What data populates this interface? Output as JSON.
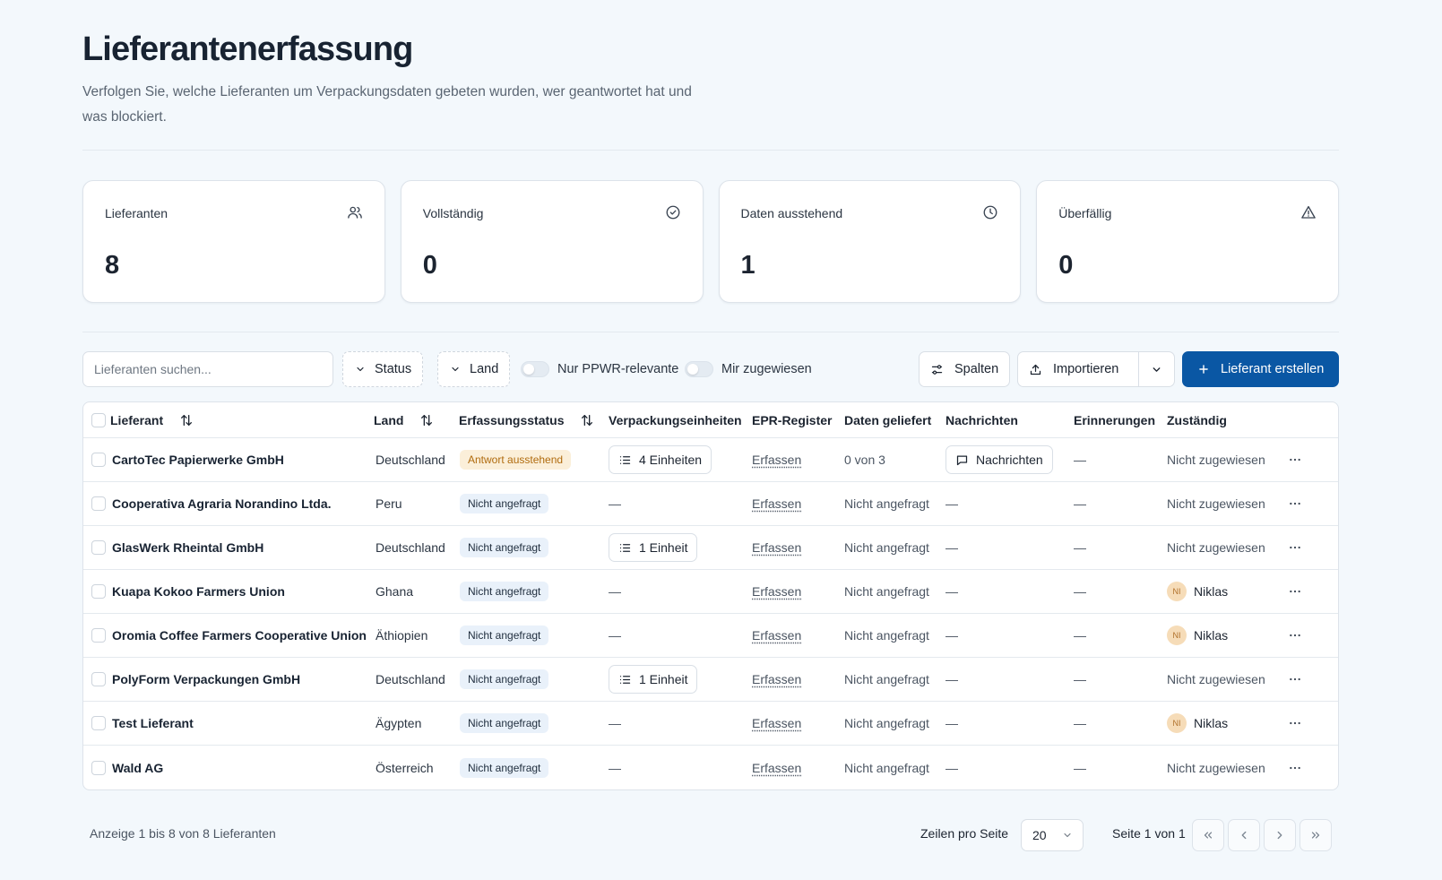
{
  "header": {
    "title": "Lieferantenerfassung",
    "subtitle": "Verfolgen Sie, welche Lieferanten um Verpackungsdaten gebeten wurden, wer geantwortet hat und was blockiert."
  },
  "stats": [
    {
      "label": "Lieferanten",
      "value": "8",
      "icon": "users-icon"
    },
    {
      "label": "Vollständig",
      "value": "0",
      "icon": "check-circle-icon"
    },
    {
      "label": "Daten ausstehend",
      "value": "1",
      "icon": "clock-icon"
    },
    {
      "label": "Überfällig",
      "value": "0",
      "icon": "alert-triangle-icon"
    }
  ],
  "toolbar": {
    "search_placeholder": "Lieferanten suchen...",
    "status_filter": "Status",
    "country_filter": "Land",
    "toggle_ppwr": "Nur PPWR-relevante",
    "toggle_assigned": "Mir zugewiesen",
    "columns_button": "Spalten",
    "import_button": "Importieren",
    "create_button": "Lieferant erstellen"
  },
  "table": {
    "columns": [
      "Lieferant",
      "Land",
      "Erfassungsstatus",
      "Verpackungseinheiten",
      "EPR-Register",
      "Daten geliefert",
      "Nachrichten",
      "Erinnerungen",
      "Zuständig"
    ],
    "rows": [
      {
        "name": "CartoTec Papierwerke GmbH",
        "country": "Deutschland",
        "status": "Antwort ausstehend",
        "status_variant": "amber",
        "units": "4 Einheiten",
        "epr": "Erfassen",
        "delivered": "0 von 3",
        "messages": "Nachrichten",
        "reminders": "—",
        "assignee": "Nicht zugewiesen",
        "assignee_initials": ""
      },
      {
        "name": "Cooperativa Agraria Norandino Ltda.",
        "country": "Peru",
        "status": "Nicht angefragt",
        "status_variant": "blue",
        "units": "—",
        "epr": "Erfassen",
        "delivered": "Nicht angefragt",
        "messages": "—",
        "reminders": "—",
        "assignee": "Nicht zugewiesen",
        "assignee_initials": ""
      },
      {
        "name": "GlasWerk Rheintal GmbH",
        "country": "Deutschland",
        "status": "Nicht angefragt",
        "status_variant": "blue",
        "units": "1 Einheit",
        "epr": "Erfassen",
        "delivered": "Nicht angefragt",
        "messages": "—",
        "reminders": "—",
        "assignee": "Nicht zugewiesen",
        "assignee_initials": ""
      },
      {
        "name": "Kuapa Kokoo Farmers Union",
        "country": "Ghana",
        "status": "Nicht angefragt",
        "status_variant": "blue",
        "units": "—",
        "epr": "Erfassen",
        "delivered": "Nicht angefragt",
        "messages": "—",
        "reminders": "—",
        "assignee": "Niklas",
        "assignee_initials": "NI"
      },
      {
        "name": "Oromia Coffee Farmers Cooperative Union",
        "country": "Äthiopien",
        "status": "Nicht angefragt",
        "status_variant": "blue",
        "units": "—",
        "epr": "Erfassen",
        "delivered": "Nicht angefragt",
        "messages": "—",
        "reminders": "—",
        "assignee": "Niklas",
        "assignee_initials": "NI"
      },
      {
        "name": "PolyForm Verpackungen GmbH",
        "country": "Deutschland",
        "status": "Nicht angefragt",
        "status_variant": "blue",
        "units": "1 Einheit",
        "epr": "Erfassen",
        "delivered": "Nicht angefragt",
        "messages": "—",
        "reminders": "—",
        "assignee": "Nicht zugewiesen",
        "assignee_initials": ""
      },
      {
        "name": "Test Lieferant",
        "country": "Ägypten",
        "status": "Nicht angefragt",
        "status_variant": "blue",
        "units": "—",
        "epr": "Erfassen",
        "delivered": "Nicht angefragt",
        "messages": "—",
        "reminders": "—",
        "assignee": "Niklas",
        "assignee_initials": "NI"
      },
      {
        "name": "Wald AG",
        "country": "Österreich",
        "status": "Nicht angefragt",
        "status_variant": "blue",
        "units": "—",
        "epr": "Erfassen",
        "delivered": "Nicht angefragt",
        "messages": "—",
        "reminders": "—",
        "assignee": "Nicht zugewiesen",
        "assignee_initials": ""
      }
    ]
  },
  "footer": {
    "summary": "Anzeige 1 bis 8 von 8 Lieferanten",
    "rows_per_page_label": "Zeilen pro Seite",
    "rows_per_page_value": "20",
    "page_info": "Seite 1 von 1"
  },
  "colors": {
    "primary": "#0a57a4",
    "background": "#f3f8fc",
    "badge_amber_bg": "#fbefd9",
    "badge_amber_text": "#b06b0e",
    "badge_blue_bg": "#e9f1fa",
    "avatar_bg": "#f6dcb8"
  }
}
